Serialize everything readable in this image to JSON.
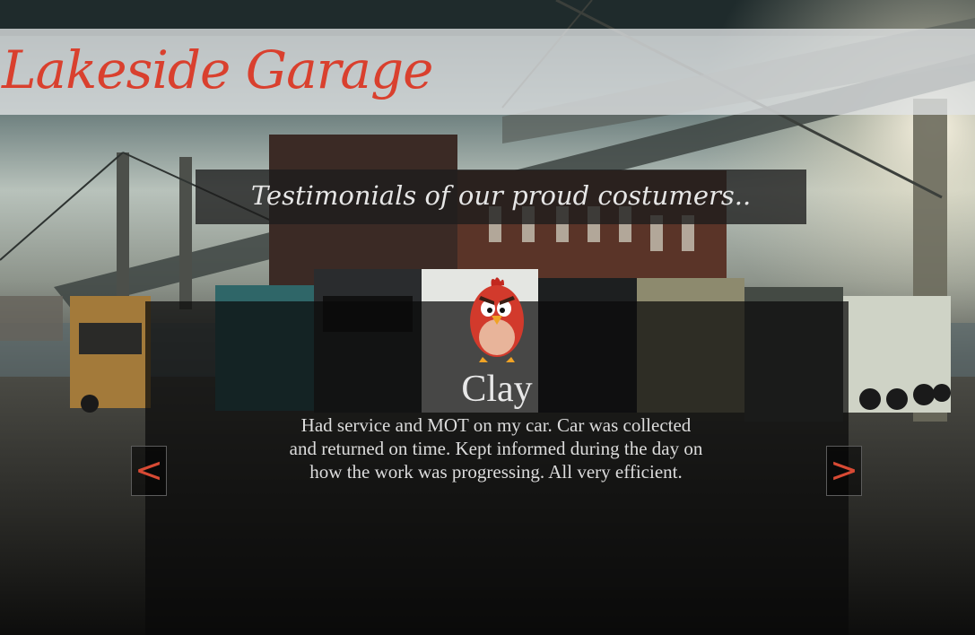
{
  "header": {
    "site_title": "Lakeside Garage"
  },
  "section": {
    "heading": "Testimonials of our proud costumers.."
  },
  "testimonial": {
    "avatar_icon": "red-bird-avatar-icon",
    "author": "Clay",
    "quote": "Had service and MOT on my car. Car was collected and returned on time. Kept informed during the day on how the work was progressing. All very efficient."
  },
  "carousel": {
    "prev_label": "<",
    "next_label": ">"
  },
  "colors": {
    "brand_red": "#d9402e",
    "arrow_red": "#d84a34"
  }
}
